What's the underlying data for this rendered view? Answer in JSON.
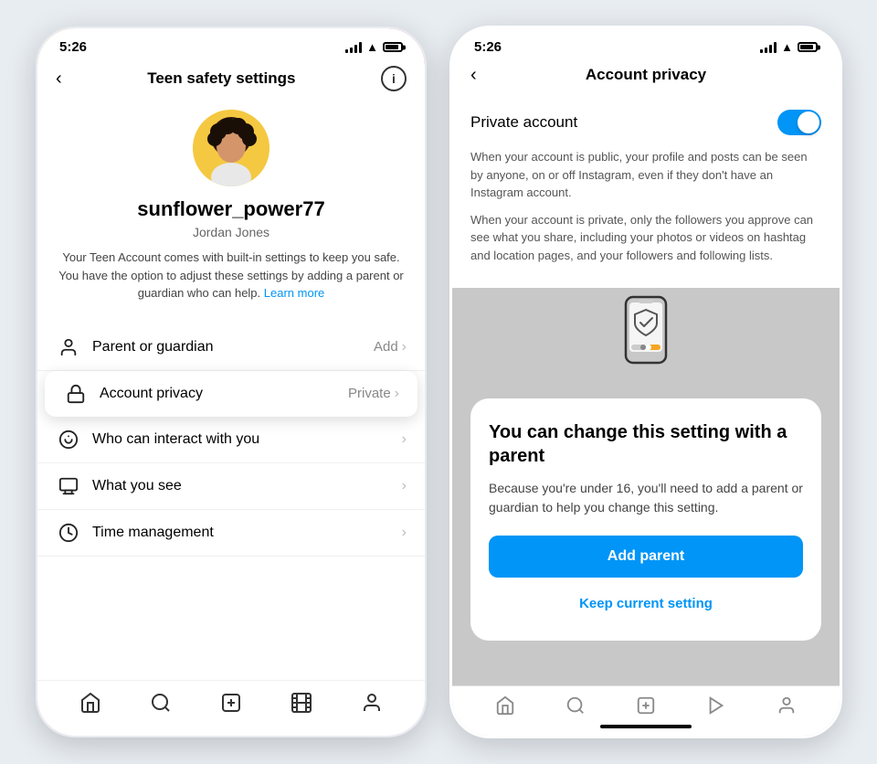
{
  "left_phone": {
    "status_time": "5:26",
    "header_title": "Teen safety settings",
    "username": "sunflower_power77",
    "realname": "Jordan Jones",
    "description": "Your Teen Account comes with built-in settings to keep you safe. You have the option to adjust these settings by adding a parent or guardian who can help.",
    "learn_more": "Learn more",
    "menu_items": [
      {
        "id": "parent",
        "label": "Parent or guardian",
        "right": "Add",
        "has_chevron": true
      },
      {
        "id": "privacy",
        "label": "Account privacy",
        "right": "Private",
        "has_chevron": true,
        "highlighted": true
      },
      {
        "id": "interact",
        "label": "Who can interact with you",
        "right": "",
        "has_chevron": true
      },
      {
        "id": "see",
        "label": "What you see",
        "right": "",
        "has_chevron": true
      },
      {
        "id": "time",
        "label": "Time management",
        "right": "",
        "has_chevron": true
      }
    ]
  },
  "right_phone": {
    "status_time": "5:26",
    "header_title": "Account privacy",
    "privacy_label": "Private account",
    "toggle_on": true,
    "desc1": "When your account is public, your profile and posts can be seen by anyone, on or off Instagram, even if they don't have an Instagram account.",
    "desc2": "When your account is private, only the followers you approve can see what you share, including your photos or videos on hashtag and location pages, and your followers and following lists.",
    "card_title": "You can change this setting with a parent",
    "card_desc": "Because you're under 16, you'll need to add a parent or guardian to help you change this setting.",
    "add_parent_label": "Add parent",
    "keep_current_label": "Keep current setting"
  }
}
